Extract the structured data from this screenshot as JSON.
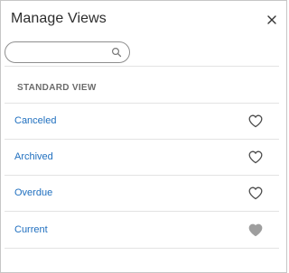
{
  "dialog": {
    "title": "Manage Views",
    "close_icon": "close-icon"
  },
  "search": {
    "value": "",
    "placeholder": "",
    "icon": "search-icon"
  },
  "section": {
    "header": "STANDARD VIEW"
  },
  "views": [
    {
      "label": "Canceled",
      "favorite": false,
      "icon": "heart-outline-icon"
    },
    {
      "label": "Archived",
      "favorite": false,
      "icon": "heart-outline-icon"
    },
    {
      "label": "Overdue",
      "favorite": false,
      "icon": "heart-outline-icon"
    },
    {
      "label": "Current",
      "favorite": true,
      "icon": "heart-filled-icon"
    }
  ],
  "colors": {
    "link": "#1f6fbf",
    "heart_outline": "#4a4a4a",
    "heart_filled": "#9e9e9e",
    "divider": "#e3e3e3"
  }
}
